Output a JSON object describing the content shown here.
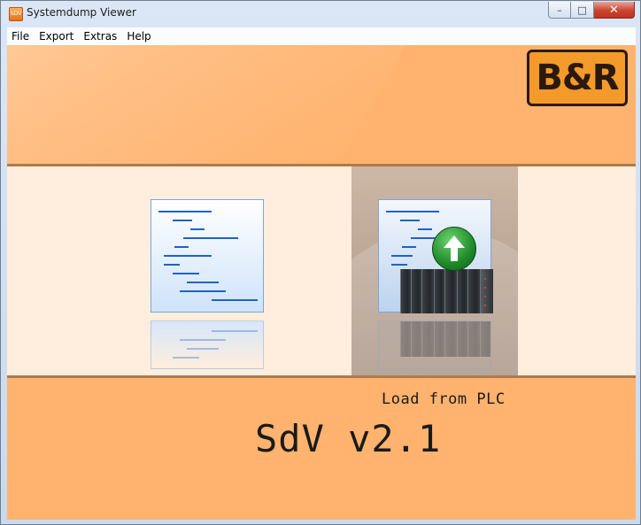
{
  "window": {
    "title": "Systemdump Viewer",
    "app_icon_label": "SDV"
  },
  "caption": {
    "minimize": "–",
    "maximize": "□",
    "close": "✕"
  },
  "menu": {
    "items": [
      "File",
      "Export",
      "Extras",
      "Help"
    ]
  },
  "logo": {
    "text": "B&R",
    "colors": {
      "fill": "#f39a2a",
      "outline": "#2b1a0c"
    }
  },
  "actions": {
    "load_from_plc": "Load from PLC"
  },
  "footer": {
    "version": "SdV v2.1"
  },
  "icons": {
    "local_file": "document-lines-icon",
    "upload": "upload-arrow-icon",
    "plc": "plc-hardware-icon"
  },
  "colors": {
    "header_orange": "#ffb36e",
    "middle_cream": "#ffeedd",
    "accent_blue": "#1e63c6",
    "upload_green": "#1f8a2a"
  }
}
